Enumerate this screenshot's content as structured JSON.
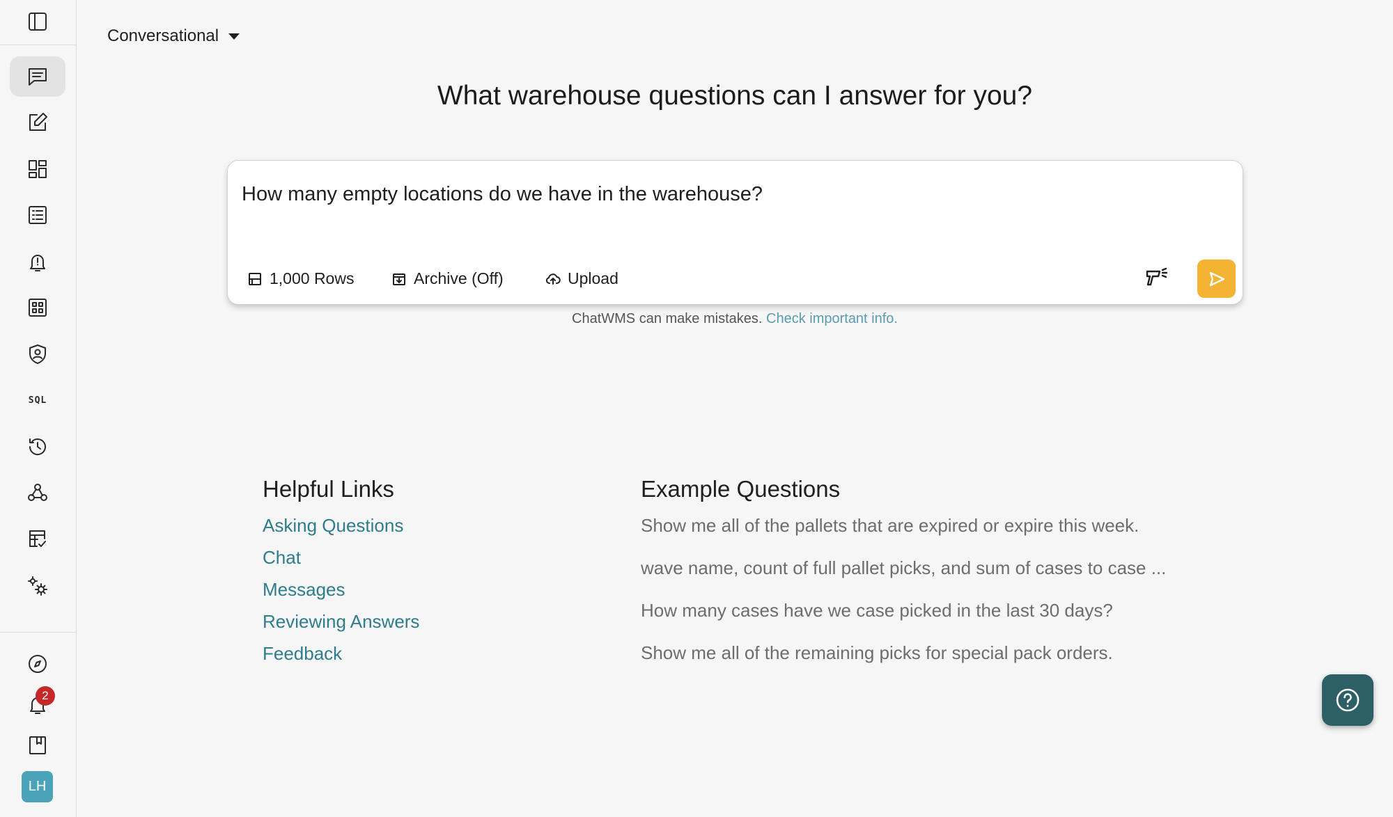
{
  "sidebar": {
    "items": [
      {
        "icon": "panel-toggle-icon"
      },
      {
        "icon": "chat-icon",
        "active": true
      },
      {
        "icon": "edit-icon"
      },
      {
        "icon": "dashboard-icon"
      },
      {
        "icon": "list-icon"
      },
      {
        "icon": "alert-bell-icon"
      },
      {
        "icon": "grid-icon"
      },
      {
        "icon": "shield-user-icon"
      },
      {
        "icon": "sql-icon",
        "label": "SQL"
      },
      {
        "icon": "history-icon"
      },
      {
        "icon": "webhook-icon"
      },
      {
        "icon": "table-check-icon"
      },
      {
        "icon": "settings-gears-icon"
      },
      {
        "icon": "compass-icon"
      },
      {
        "icon": "notifications-icon"
      },
      {
        "icon": "book-icon"
      }
    ],
    "notification_count": "2",
    "avatar_initials": "LH",
    "avatar_color": "#4aa3b8"
  },
  "header": {
    "mode": "Conversational"
  },
  "main": {
    "headline": "What warehouse questions can I answer for you?",
    "query": "How many empty locations do we have in the warehouse?",
    "tools": {
      "rows": "1,000 Rows",
      "archive": "Archive (Off)",
      "upload": "Upload"
    },
    "send_color": "#f5b333",
    "disclaimer_text": "ChatWMS can make mistakes.",
    "disclaimer_link": "Check important info."
  },
  "helpful_links": {
    "title": "Helpful Links",
    "items": [
      "Asking Questions",
      "Chat",
      "Messages",
      "Reviewing Answers",
      "Feedback"
    ]
  },
  "example_questions": {
    "title": "Example Questions",
    "items": [
      "Show me all of the pallets that are expired or expire this week.",
      "wave name, count of full pallet picks, and sum of cases to case ...",
      "How many cases have we case picked in the last 30 days?",
      "Show me all of the remaining picks for special pack orders."
    ]
  },
  "colors": {
    "link": "#2e7d8c",
    "help_button": "#2d5f66",
    "badge": "#c62828"
  }
}
